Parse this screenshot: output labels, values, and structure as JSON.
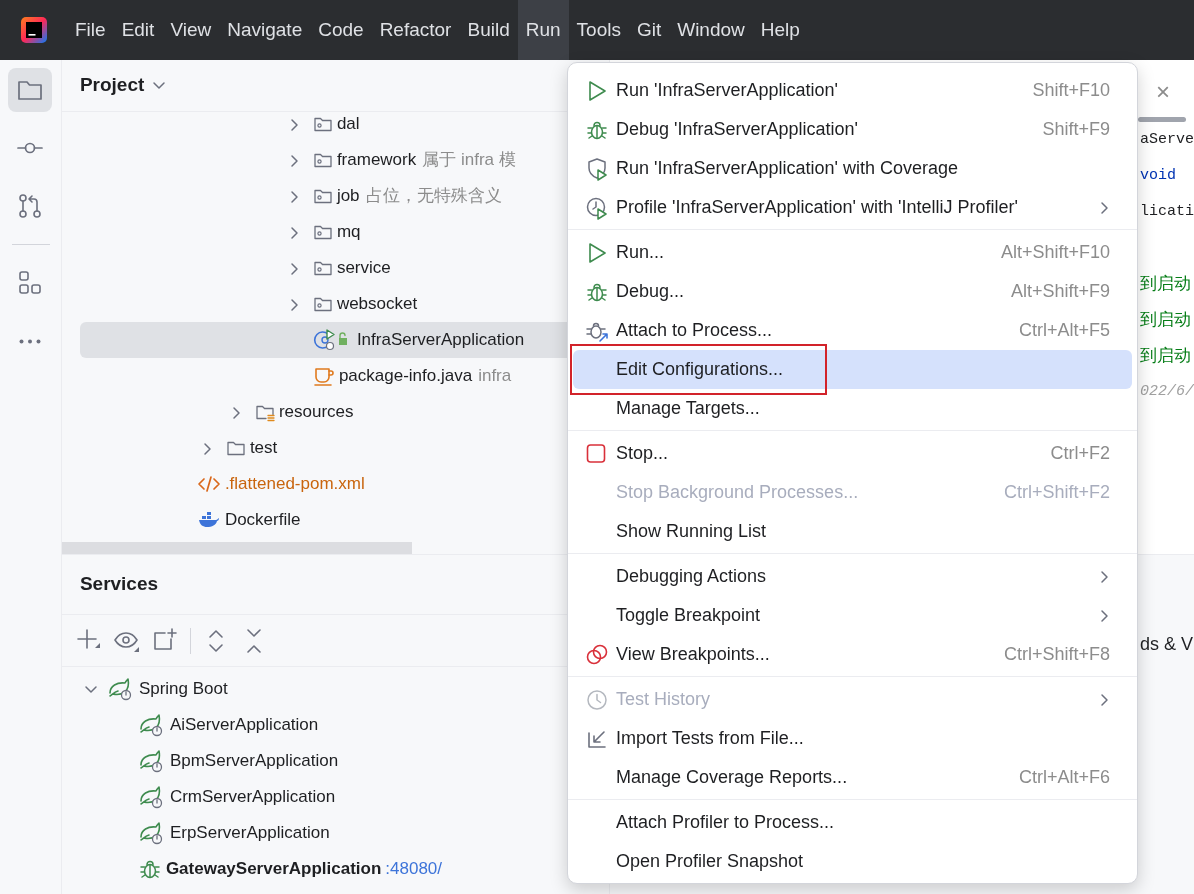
{
  "menubar": {
    "items": [
      {
        "label": "File",
        "selected": false
      },
      {
        "label": "Edit",
        "selected": false
      },
      {
        "label": "View",
        "selected": false
      },
      {
        "label": "Navigate",
        "selected": false
      },
      {
        "label": "Code",
        "selected": false
      },
      {
        "label": "Refactor",
        "selected": false
      },
      {
        "label": "Build",
        "selected": false
      },
      {
        "label": "Run",
        "selected": true
      },
      {
        "label": "Tools",
        "selected": false
      },
      {
        "label": "Git",
        "selected": false
      },
      {
        "label": "Window",
        "selected": false
      },
      {
        "label": "Help",
        "selected": false
      }
    ]
  },
  "tool_strip": {
    "items": [
      {
        "kind": "project",
        "selected": true
      },
      {
        "kind": "commit",
        "selected": false
      },
      {
        "kind": "pull_requests",
        "selected": false
      },
      {
        "kind": "structure",
        "selected": false
      },
      {
        "kind": "more",
        "selected": false
      }
    ]
  },
  "project_panel": {
    "title": "Project",
    "tree": [
      {
        "children": [
          {
            "children": [
              {
                "children": [
                  {
                    "children": [
                      {
                        "label": "dal",
                        "kind": "package",
                        "expanded": false,
                        "selected": false
                      },
                      {
                        "label": "framework",
                        "note": "属于 infra 模",
                        "kind": "package",
                        "expanded": false,
                        "selected": false
                      },
                      {
                        "label": "job",
                        "note": "占位，无特殊含义",
                        "kind": "package",
                        "expanded": false,
                        "selected": false
                      },
                      {
                        "label": "mq",
                        "kind": "package",
                        "expanded": false,
                        "selected": false
                      },
                      {
                        "label": "service",
                        "kind": "package",
                        "expanded": false,
                        "selected": false
                      },
                      {
                        "label": "websocket",
                        "kind": "package",
                        "expanded": false,
                        "selected": false
                      },
                      {
                        "label": "InfraServerApplication",
                        "kind": "spring_class",
                        "selected": true
                      },
                      {
                        "label": "package-info.java",
                        "note": "infra",
                        "kind": "java_file",
                        "selected": false
                      }
                    ]
                  }
                ]
              },
              {
                "label": "resources",
                "kind": "resources",
                "expanded": false,
                "selected": false
              }
            ]
          },
          {
            "label": "test",
            "kind": "folder",
            "expanded": false,
            "selected": false
          }
        ]
      },
      {
        "label": ".flattened-pom.xml",
        "kind": "xml",
        "selected": false
      },
      {
        "label": "Dockerfile",
        "kind": "docker",
        "selected": false
      }
    ]
  },
  "services_panel": {
    "title": "Services",
    "tree": [
      {
        "label": "Spring Boot",
        "kind": "group",
        "expanded": true,
        "children": [
          {
            "label": "AiServerApplication",
            "kind": "app",
            "running": false
          },
          {
            "label": "BpmServerApplication",
            "kind": "app",
            "running": false
          },
          {
            "label": "CrmServerApplication",
            "kind": "app",
            "running": false
          },
          {
            "label": "ErpServerApplication",
            "kind": "app",
            "running": false
          },
          {
            "label": "GatewayServerApplication",
            "port": ":48080/",
            "kind": "app",
            "running": true
          }
        ]
      }
    ]
  },
  "editor": {
    "close": "×",
    "lines": [
      {
        "kind": "code",
        "text": "aServe"
      },
      {
        "kind": "keyword",
        "text": "void"
      },
      {
        "kind": "code",
        "text": "licati"
      },
      {
        "kind": "blank"
      },
      {
        "kind": "string",
        "text": "到启动"
      },
      {
        "kind": "string",
        "text": "到启动"
      },
      {
        "kind": "string",
        "text": "到启动"
      },
      {
        "kind": "hint",
        "text": "022/6/"
      }
    ]
  },
  "bottom_right_panel": {
    "text": "ds & V"
  },
  "run_menu": {
    "sections": [
      [
        {
          "label": "Run 'InfraServerApplication'",
          "shortcut": "Shift+F10",
          "kind": "run",
          "disabled": false,
          "selected": false,
          "has_submenu": false,
          "outlined": false
        },
        {
          "label": "Debug 'InfraServerApplication'",
          "shortcut": "Shift+F9",
          "kind": "debug",
          "disabled": false,
          "selected": false,
          "has_submenu": false,
          "outlined": false
        },
        {
          "label": "Run 'InfraServerApplication' with Coverage",
          "kind": "coverage",
          "disabled": false,
          "selected": false,
          "has_submenu": false,
          "outlined": false
        },
        {
          "label": "Profile 'InfraServerApplication' with 'IntelliJ Profiler'",
          "kind": "profile",
          "disabled": false,
          "selected": false,
          "has_submenu": true,
          "outlined": false
        }
      ],
      [
        {
          "label": "Run...",
          "shortcut": "Alt+Shift+F10",
          "kind": "run",
          "disabled": false,
          "selected": false,
          "has_submenu": false,
          "outlined": false
        },
        {
          "label": "Debug...",
          "shortcut": "Alt+Shift+F9",
          "kind": "debug",
          "disabled": false,
          "selected": false,
          "has_submenu": false,
          "outlined": false
        },
        {
          "label": "Attach to Process...",
          "shortcut": "Ctrl+Alt+F5",
          "kind": "attach",
          "disabled": false,
          "selected": false,
          "has_submenu": false,
          "outlined": false
        },
        {
          "label": "Edit Configurations...",
          "kind": "plain",
          "disabled": false,
          "selected": true,
          "has_submenu": false,
          "outlined": true
        },
        {
          "label": "Manage Targets...",
          "kind": "plain",
          "disabled": false,
          "selected": false,
          "has_submenu": false,
          "outlined": false
        }
      ],
      [
        {
          "label": "Stop...",
          "shortcut": "Ctrl+F2",
          "kind": "stop",
          "disabled": false,
          "selected": false,
          "has_submenu": false,
          "outlined": false
        },
        {
          "label": "Stop Background Processes...",
          "shortcut": "Ctrl+Shift+F2",
          "kind": "plain",
          "disabled": true,
          "selected": false,
          "has_submenu": false,
          "outlined": false
        },
        {
          "label": "Show Running List",
          "kind": "plain",
          "disabled": false,
          "selected": false,
          "has_submenu": false,
          "outlined": false
        }
      ],
      [
        {
          "label": "Debugging Actions",
          "kind": "plain",
          "disabled": false,
          "selected": false,
          "has_submenu": true,
          "outlined": false
        },
        {
          "label": "Toggle Breakpoint",
          "kind": "plain",
          "disabled": false,
          "selected": false,
          "has_submenu": true,
          "outlined": false
        },
        {
          "label": "View Breakpoints...",
          "shortcut": "Ctrl+Shift+F8",
          "kind": "breakpoints",
          "disabled": false,
          "selected": false,
          "has_submenu": false,
          "outlined": false
        }
      ],
      [
        {
          "label": "Test History",
          "kind": "history",
          "disabled": true,
          "selected": false,
          "has_submenu": true,
          "outlined": false
        },
        {
          "label": "Import Tests from File...",
          "kind": "import",
          "disabled": false,
          "selected": false,
          "has_submenu": false,
          "outlined": false
        },
        {
          "label": "Manage Coverage Reports...",
          "shortcut": "Ctrl+Alt+F6",
          "kind": "plain",
          "disabled": false,
          "selected": false,
          "has_submenu": false,
          "outlined": false
        }
      ],
      [
        {
          "label": "Attach Profiler to Process...",
          "kind": "plain",
          "disabled": false,
          "selected": false,
          "has_submenu": false,
          "outlined": false
        },
        {
          "label": "Open Profiler Snapshot",
          "kind": "plain",
          "disabled": false,
          "selected": false,
          "has_submenu": false,
          "outlined": false
        }
      ]
    ]
  }
}
